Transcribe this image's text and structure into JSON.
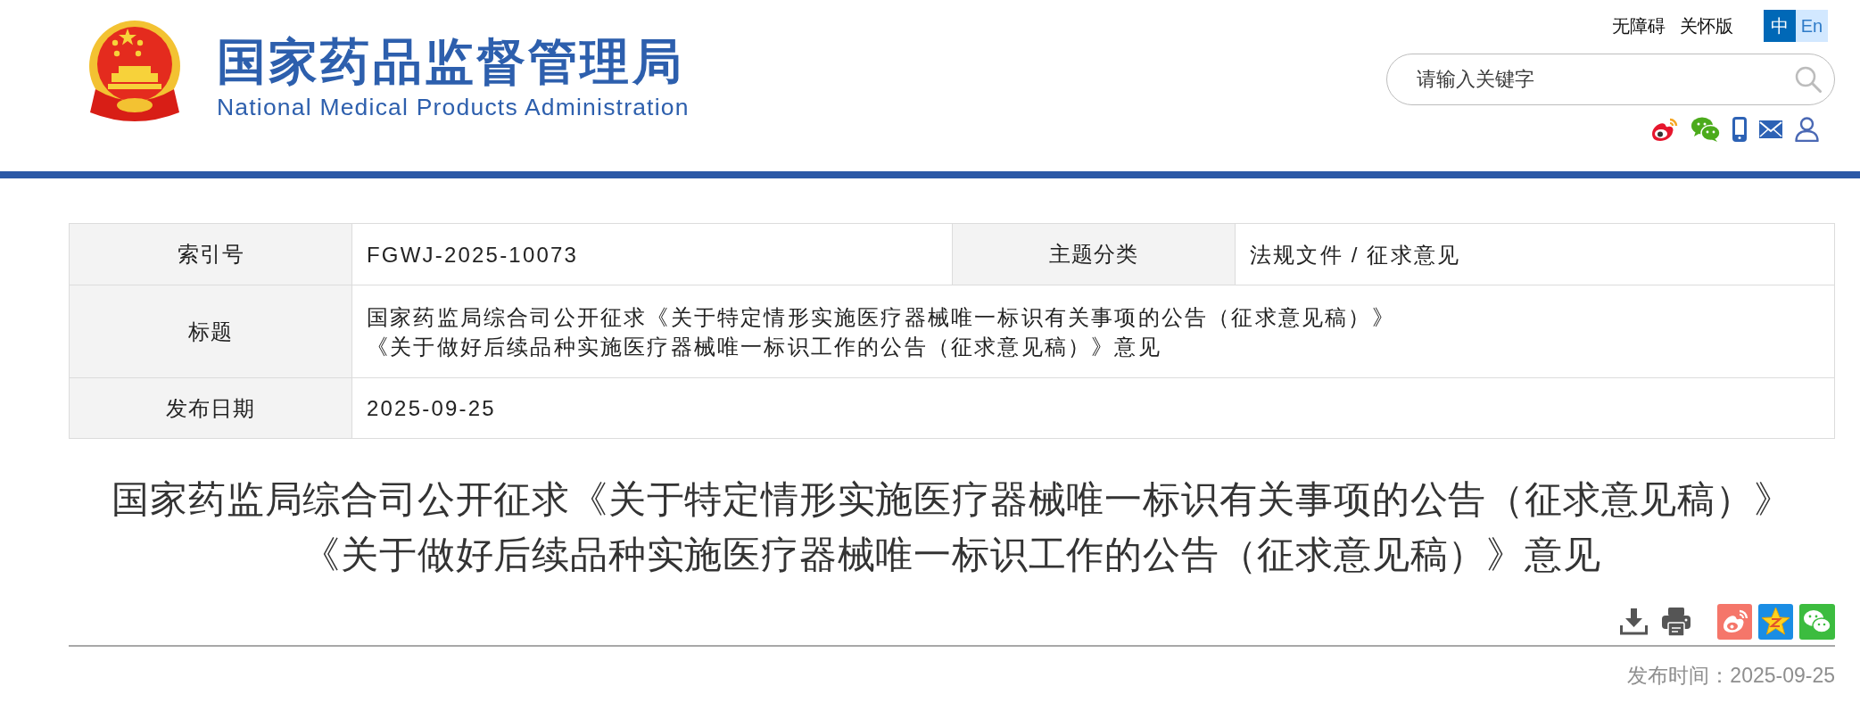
{
  "header": {
    "title": "国家药品监督管理局",
    "subtitle": "National Medical Products Administration",
    "top_links": [
      {
        "label": "无障碍"
      },
      {
        "label": "关怀版"
      }
    ],
    "languages": [
      {
        "label": "中",
        "selected": true
      },
      {
        "label": "En",
        "selected": false
      }
    ],
    "search": {
      "placeholder": "请输入关键字"
    }
  },
  "info_table": {
    "rows": [
      {
        "cells": [
          {
            "label": "索引号",
            "value": [
              "FGWJ-2025-10073"
            ]
          },
          {
            "label": "主题分类",
            "value": [
              "法规文件 / 征求意见"
            ]
          }
        ]
      },
      {
        "cells": [
          {
            "label": "标题",
            "value": [
              "国家药监局综合司公开征求《关于特定情形实施医疗器械唯一标识有关事项的公告（征求意见稿）》",
              "《关于做好后续品种实施医疗器械唯一标识工作的公告（征求意见稿）》意见"
            ]
          }
        ]
      },
      {
        "cells": [
          {
            "label": "发布日期",
            "value": [
              "2025-09-25"
            ]
          }
        ]
      }
    ]
  },
  "article": {
    "title_lines": [
      "国家药监局综合司公开征求《关于特定情形实施医疗器械唯一标识有关事项的公告（征求意见稿）》",
      "《关于做好后续品种实施医疗器械唯一标识工作的公告（征求意见稿）》意见"
    ],
    "publish_time": "发布时间：2025-09-25"
  }
}
